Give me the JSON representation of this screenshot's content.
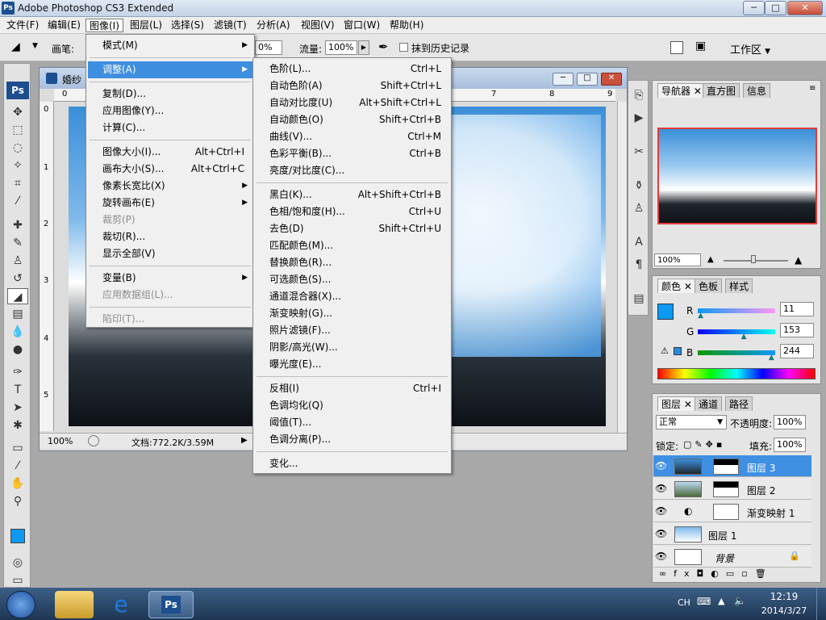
{
  "window": {
    "app_title": "Adobe Photoshop CS3 Extended",
    "ps_badge": "Ps",
    "min": "─",
    "max": "□",
    "close": "✕"
  },
  "menubar": [
    "文件(F)",
    "编辑(E)",
    "图像(I)",
    "图层(L)",
    "选择(S)",
    "滤镜(T)",
    "分析(A)",
    "视图(V)",
    "窗口(W)",
    "帮助(H)"
  ],
  "options": {
    "brush_label": "画笔:",
    "opacity_partial": "0%",
    "flow_label": "流量:",
    "flow_value": "100%",
    "history_label": "抹到历史记录",
    "workspace": "工作区"
  },
  "document": {
    "title": "婚纱",
    "ruler_h": [
      "0",
      "7",
      "8",
      "9"
    ],
    "ruler_v": [
      "0",
      "1",
      "2",
      "3",
      "4",
      "5"
    ],
    "zoom": "100%",
    "doc_size": "文档:772.2K/3.59M"
  },
  "image_menu": [
    {
      "label": "模式(M)",
      "arrow": true
    },
    {
      "sep": true
    },
    {
      "label": "调整(A)",
      "arrow": true,
      "highlight": true
    },
    {
      "sep": true
    },
    {
      "label": "复制(D)..."
    },
    {
      "label": "应用图像(Y)..."
    },
    {
      "label": "计算(C)..."
    },
    {
      "sep": true
    },
    {
      "label": "图像大小(I)...",
      "shortcut": "Alt+Ctrl+I"
    },
    {
      "label": "画布大小(S)...",
      "shortcut": "Alt+Ctrl+C"
    },
    {
      "label": "像素长宽比(X)",
      "arrow": true
    },
    {
      "label": "旋转画布(E)",
      "arrow": true
    },
    {
      "label": "裁剪(P)",
      "disabled": true
    },
    {
      "label": "裁切(R)..."
    },
    {
      "label": "显示全部(V)"
    },
    {
      "sep": true
    },
    {
      "label": "变量(B)",
      "arrow": true
    },
    {
      "label": "应用数据组(L)...",
      "disabled": true
    },
    {
      "sep": true
    },
    {
      "label": "陷印(T)...",
      "disabled": true
    }
  ],
  "adjust_menu": [
    {
      "label": "色阶(L)...",
      "shortcut": "Ctrl+L"
    },
    {
      "label": "自动色阶(A)",
      "shortcut": "Shift+Ctrl+L"
    },
    {
      "label": "自动对比度(U)",
      "shortcut": "Alt+Shift+Ctrl+L"
    },
    {
      "label": "自动颜色(O)",
      "shortcut": "Shift+Ctrl+B"
    },
    {
      "label": "曲线(V)...",
      "shortcut": "Ctrl+M"
    },
    {
      "label": "色彩平衡(B)...",
      "shortcut": "Ctrl+B"
    },
    {
      "label": "亮度/对比度(C)..."
    },
    {
      "sep": true
    },
    {
      "label": "黑白(K)...",
      "shortcut": "Alt+Shift+Ctrl+B"
    },
    {
      "label": "色相/饱和度(H)...",
      "shortcut": "Ctrl+U"
    },
    {
      "label": "去色(D)",
      "shortcut": "Shift+Ctrl+U"
    },
    {
      "label": "匹配颜色(M)..."
    },
    {
      "label": "替换颜色(R)..."
    },
    {
      "label": "可选颜色(S)..."
    },
    {
      "label": "通道混合器(X)..."
    },
    {
      "label": "渐变映射(G)..."
    },
    {
      "label": "照片滤镜(F)..."
    },
    {
      "label": "阴影/高光(W)..."
    },
    {
      "label": "曝光度(E)..."
    },
    {
      "sep": true
    },
    {
      "label": "反相(I)",
      "shortcut": "Ctrl+I"
    },
    {
      "label": "色调均化(Q)"
    },
    {
      "label": "阈值(T)..."
    },
    {
      "label": "色调分离(P)..."
    },
    {
      "sep": true
    },
    {
      "label": "变化..."
    }
  ],
  "navigator": {
    "tabs": [
      "导航器",
      "直方图",
      "信息"
    ],
    "zoom": "100%"
  },
  "color_panel": {
    "tabs": [
      "颜色",
      "色板",
      "样式"
    ],
    "r_label": "R",
    "g_label": "G",
    "b_label": "B",
    "r": "11",
    "g": "153",
    "b": "244",
    "r_frac": 0.043,
    "g_frac": 0.6,
    "b_frac": 0.957,
    "fg_color": "#0b99f4"
  },
  "layers_panel": {
    "tabs": [
      "图层",
      "通道",
      "路径"
    ],
    "blend_mode": "正常",
    "opacity_label": "不透明度:",
    "opacity": "100%",
    "lock_label": "锁定:",
    "fill_label": "填充:",
    "fill": "100%",
    "layers": [
      {
        "name": "图层 3",
        "selected": true,
        "mask": true
      },
      {
        "name": "图层 2",
        "mask": true
      },
      {
        "name": "渐变映射 1",
        "adjustment": true
      },
      {
        "name": "图层 1"
      },
      {
        "name": "背景",
        "locked": true
      }
    ]
  },
  "taskbar": {
    "lang": "CH",
    "time": "12:19",
    "date": "2014/3/27"
  },
  "colors": {
    "highlight": "#3e8ee0",
    "selected_layer": "#3f8fe2",
    "fg_swatch": "#0b99f4"
  }
}
